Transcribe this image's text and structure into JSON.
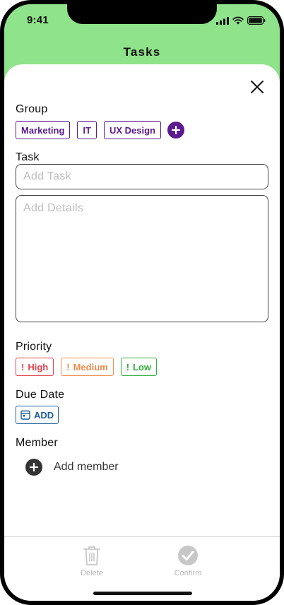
{
  "status_bar": {
    "time": "9:41"
  },
  "header": {
    "title": "Tasks"
  },
  "group": {
    "label": "Group",
    "chips": [
      "Marketing",
      "IT",
      "UX Design"
    ]
  },
  "task": {
    "label": "Task",
    "title_placeholder": "Add Task",
    "details_placeholder": "Add Details"
  },
  "priority": {
    "label": "Priority",
    "options": [
      {
        "mark": "!",
        "text": "High",
        "color": "#e2424f"
      },
      {
        "mark": "!",
        "text": "Medium",
        "color": "#ef8d4d"
      },
      {
        "mark": "!",
        "text": "Low",
        "color": "#2fae3a"
      }
    ]
  },
  "due_date": {
    "label": "Due Date",
    "button": "ADD"
  },
  "member": {
    "label": "Member",
    "add_text": "Add member"
  },
  "actions": {
    "delete": "Delete",
    "confirm": "Confirm"
  },
  "colors": {
    "header_bg": "#8fe38a",
    "group_accent": "#5c1a8e",
    "date_accent": "#1b5c9a",
    "disabled": "#b8b8b8"
  }
}
